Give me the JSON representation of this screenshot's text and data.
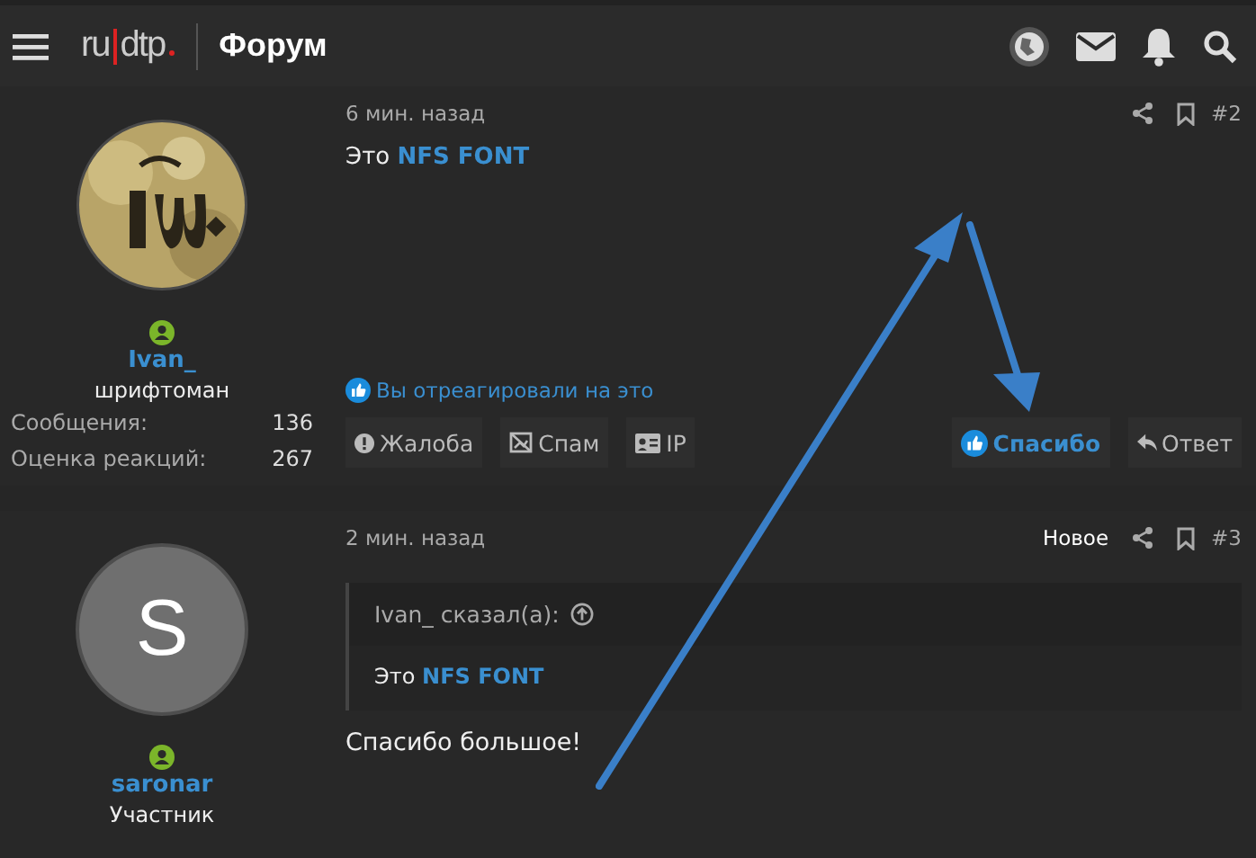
{
  "header": {
    "logo_left": "ru",
    "logo_right": "dtp",
    "title": "Форум"
  },
  "posts": [
    {
      "avatar": {
        "kind": "picture"
      },
      "online": true,
      "author": "Ivan_",
      "role": "шрифтоман",
      "stats": [
        {
          "label": "Сообщения:",
          "value": "136"
        },
        {
          "label": "Оценка реакций:",
          "value": "267"
        }
      ],
      "time": "6 мин. назад",
      "number": "#2",
      "body_prefix": "Это",
      "body_link": "NFS FONT",
      "reaction": "Вы отреагировали на это",
      "actions_left": [
        {
          "kind": "report",
          "label": "Жалоба"
        },
        {
          "kind": "spam",
          "label": "Спам"
        },
        {
          "kind": "ip",
          "label": "IP"
        }
      ],
      "actions_right": [
        {
          "kind": "like",
          "label": "Спасибо",
          "active": true
        },
        {
          "kind": "reply",
          "label": "Ответ",
          "active": false
        }
      ]
    },
    {
      "avatar": {
        "kind": "letter",
        "letter": "S"
      },
      "online": true,
      "author": "saronar",
      "role": "Участник",
      "time": "2 мин. назад",
      "new_label": "Новое",
      "number": "#3",
      "quote": {
        "author": "Ivan_ сказал(а):",
        "body_prefix": "Это",
        "body_link": "NFS FONT"
      },
      "text": "Спасибо большое!"
    }
  ]
}
